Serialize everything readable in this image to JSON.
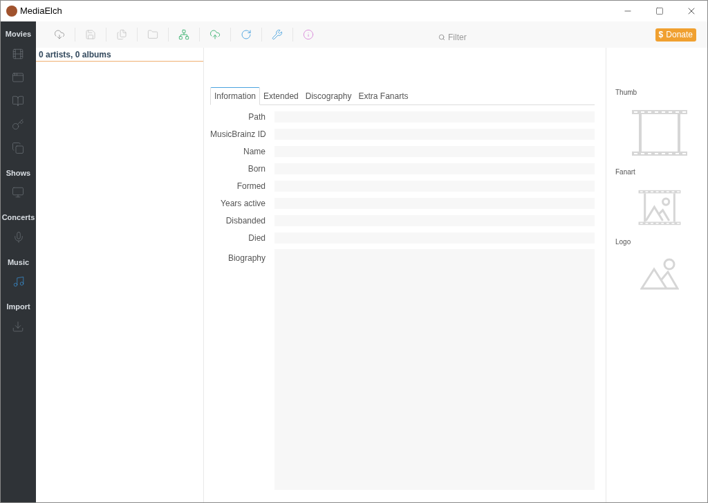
{
  "window": {
    "title": "MediaElch"
  },
  "sidebar": [
    {
      "label": "Movies",
      "items": [
        {
          "kind": "film",
          "selected": false
        },
        {
          "kind": "sets",
          "selected": false
        },
        {
          "kind": "genres",
          "selected": false
        },
        {
          "kind": "certification",
          "selected": false
        },
        {
          "kind": "duplicates",
          "selected": false
        }
      ]
    },
    {
      "label": "Shows",
      "items": [
        {
          "kind": "tv",
          "selected": false
        }
      ]
    },
    {
      "label": "Concerts",
      "items": [
        {
          "kind": "mic",
          "selected": false
        }
      ]
    },
    {
      "label": "Music",
      "items": [
        {
          "kind": "music",
          "selected": true
        }
      ]
    },
    {
      "label": "Import",
      "items": [
        {
          "kind": "import",
          "selected": false
        }
      ]
    }
  ],
  "toolbar": {
    "tools": [
      {
        "kind": "scrape",
        "disabled": false
      },
      {
        "kind": "save",
        "disabled": true
      },
      {
        "kind": "save-all",
        "disabled": true
      },
      {
        "kind": "folder",
        "disabled": true
      },
      {
        "kind": "network",
        "disabled": false
      },
      {
        "kind": "upload",
        "disabled": false
      },
      {
        "kind": "reload",
        "disabled": false
      },
      {
        "kind": "tools",
        "disabled": false
      },
      {
        "kind": "about",
        "disabled": false
      }
    ],
    "filter": {
      "placeholder": "Filter"
    },
    "donate": {
      "icon": "$",
      "label": "Donate"
    }
  },
  "list": {
    "summary": "0 artists, 0 albums"
  },
  "tabs": [
    {
      "label": "Information",
      "selected": true
    },
    {
      "label": "Extended",
      "selected": false
    },
    {
      "label": "Discography",
      "selected": false
    },
    {
      "label": "Extra Fanarts",
      "selected": false
    }
  ],
  "fields": [
    {
      "label": "Path"
    },
    {
      "label": "MusicBrainz ID"
    },
    {
      "label": "Name"
    },
    {
      "label": "Born"
    },
    {
      "label": "Formed"
    },
    {
      "label": "Years active"
    },
    {
      "label": "Disbanded"
    },
    {
      "label": "Died"
    }
  ],
  "biography": {
    "label": "Biography"
  },
  "images": [
    {
      "label": "Thumb",
      "kind": "film"
    },
    {
      "label": "Fanart",
      "kind": "film-image"
    },
    {
      "label": "Logo",
      "kind": "image"
    }
  ]
}
